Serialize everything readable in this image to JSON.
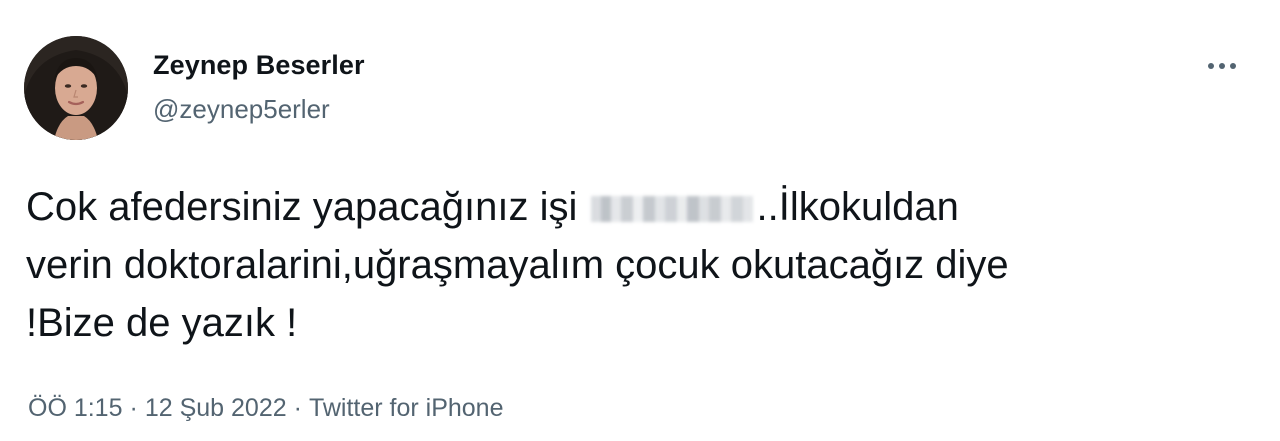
{
  "author": {
    "display_name": "Zeynep Beserler",
    "handle": "@zeynep5erler"
  },
  "more_icon": "more-horizontal-icon",
  "tweet": {
    "line1_before": "Cok afedersiniz yapacağınız işi ",
    "line1_after": "..İlkokuldan",
    "line2": "verin doktoralarini,uğraşmayalım çocuk okutacağız diye",
    "line3": "!Bize de yazık !"
  },
  "meta": {
    "time": "ÖÖ 1:15",
    "separator": "·",
    "date": "12 Şub 2022",
    "source": "Twitter for iPhone"
  },
  "colors": {
    "text": "#0f1419",
    "secondary": "#536471"
  }
}
